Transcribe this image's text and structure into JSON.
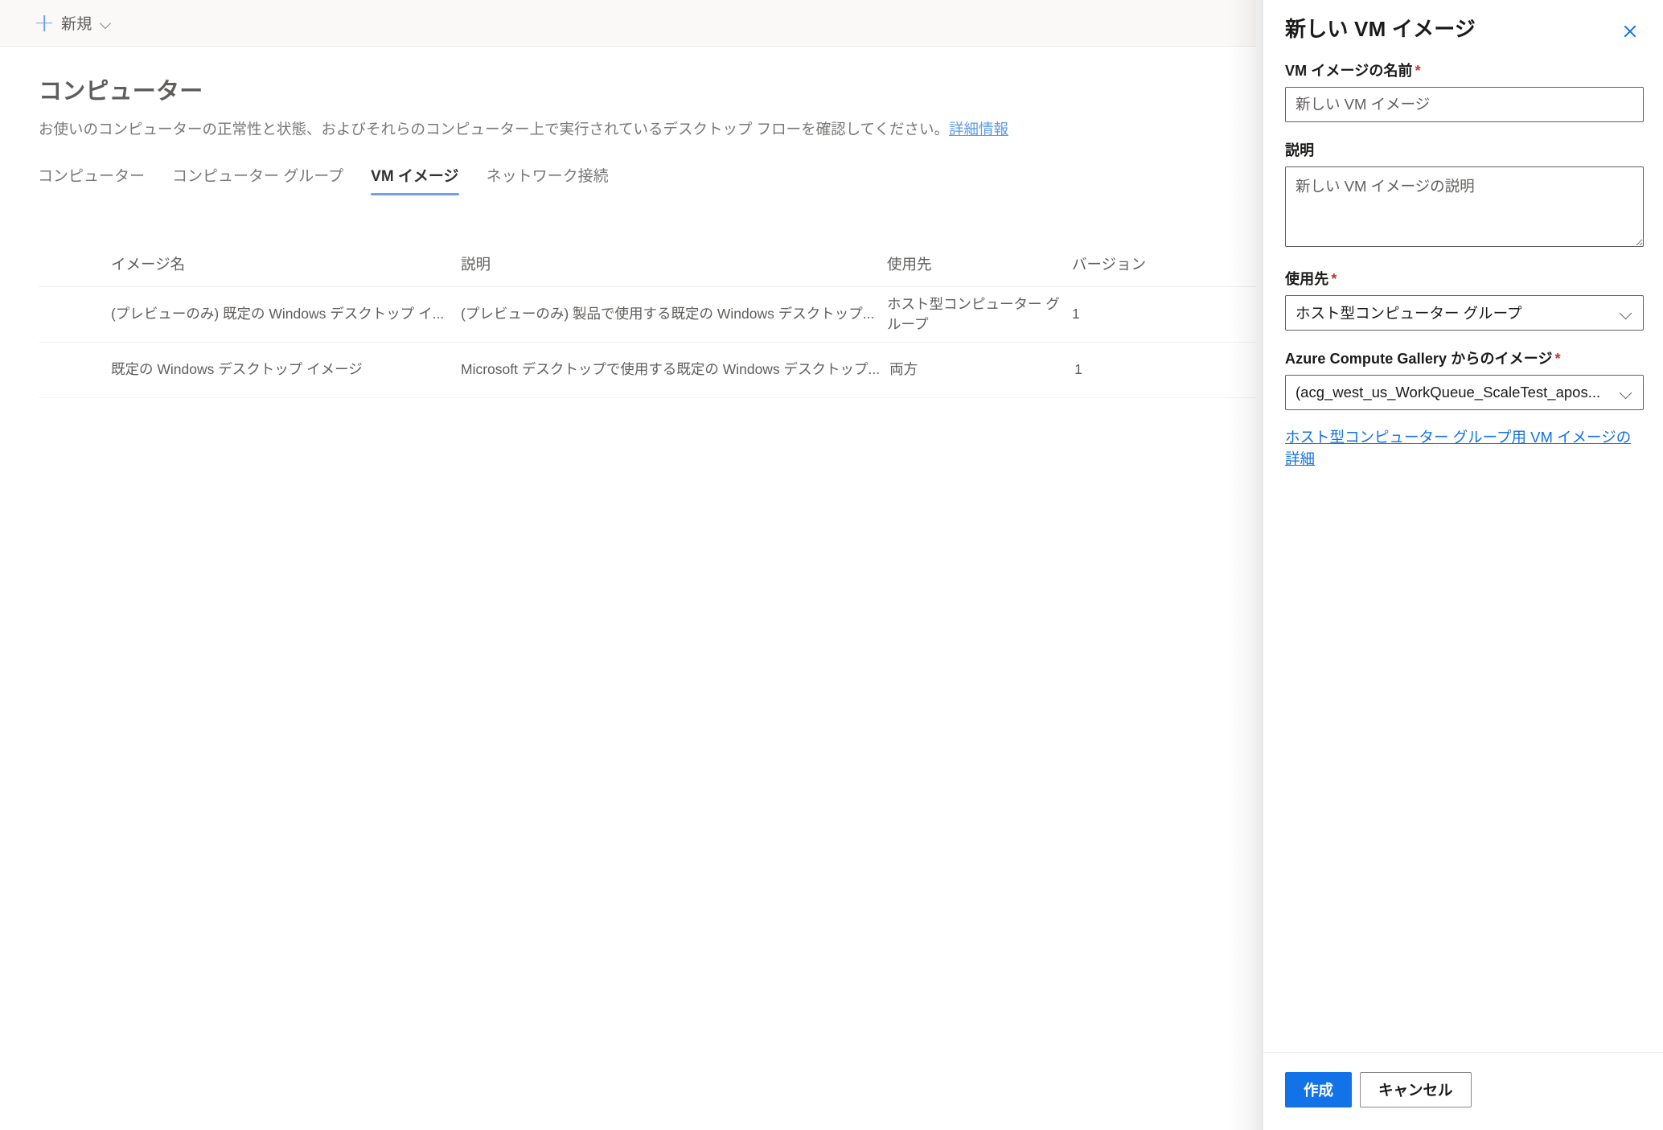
{
  "command_bar": {
    "new_button_label": "新規",
    "plus_icon": "plus-icon",
    "chevron_icon": "chevron-down-icon"
  },
  "page": {
    "title": "コンピューター",
    "description": "お使いのコンピューターの正常性と状態、およびそれらのコンピューター上で実行されているデスクトップ フローを確認してください。",
    "description_link": "詳細情報"
  },
  "tabs": [
    {
      "label": "コンピューター",
      "selected": false
    },
    {
      "label": "コンピューター グループ",
      "selected": false
    },
    {
      "label": "VM イメージ",
      "selected": true
    },
    {
      "label": "ネットワーク接続",
      "selected": false
    }
  ],
  "table": {
    "columns": [
      "イメージ名",
      "説明",
      "使用先",
      "バージョン"
    ],
    "rows": [
      {
        "name": "(プレビューのみ) 既定の Windows デスクトップ イ...",
        "description": "(プレビューのみ) 製品で使用する既定の Windows デスクトップ...",
        "usage": "ホスト型コンピューター グループ",
        "version": "1"
      },
      {
        "name": "既定の Windows デスクトップ イメージ",
        "description": "Microsoft デスクトップで使用する既定の Windows デスクトップ...",
        "usage": "両方",
        "version": "1"
      }
    ]
  },
  "panel": {
    "title": "新しい VM イメージ",
    "close_icon": "close-icon",
    "fields": {
      "name": {
        "label": "VM イメージの名前",
        "required_marker": "*",
        "placeholder": "新しい VM イメージ",
        "value": ""
      },
      "description": {
        "label": "説明",
        "required_marker": "",
        "placeholder": "新しい VM イメージの説明",
        "value": ""
      },
      "usage": {
        "label": "使用先",
        "required_marker": "*",
        "selected": "ホスト型コンピューター グループ",
        "chevron_icon": "chevron-down-icon"
      },
      "gallery_image": {
        "label": "Azure Compute Gallery からのイメージ",
        "required_marker": "*",
        "selected": "(acg_west_us_WorkQueue_ScaleTest_apos...",
        "chevron_icon": "chevron-down-icon"
      }
    },
    "help_link": "ホスト型コンピューター グループ用 VM イメージの詳細",
    "footer": {
      "primary_label": "作成",
      "secondary_label": "キャンセル"
    }
  },
  "colors": {
    "accent_blue": "#1272e7",
    "tab_underline": "#6ca0f0",
    "link_blue": "#5b9bef",
    "required_red": "#c0392b",
    "command_bar_bg": "#faf9f8"
  }
}
